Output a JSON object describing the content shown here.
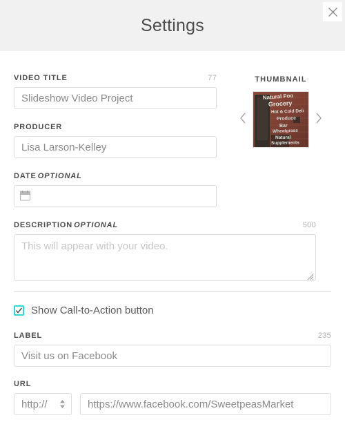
{
  "header": {
    "title": "Settings",
    "close_icon": "close-icon"
  },
  "form": {
    "video_title": {
      "label": "VIDEO TITLE",
      "counter": "77",
      "value": "Slideshow Video Project"
    },
    "producer": {
      "label": "PRODUCER",
      "value": "Lisa Larson-Kelley"
    },
    "date": {
      "label": "DATE",
      "optional": "OPTIONAL",
      "value": "",
      "placeholder": "",
      "icon": "calendar-icon"
    },
    "description": {
      "label": "DESCRIPTION",
      "optional": "OPTIONAL",
      "counter": "500",
      "value": "",
      "placeholder": "This will appear with your video."
    }
  },
  "thumbnail": {
    "label": "THUMBNAIL",
    "prev_icon": "chevron-left-icon",
    "next_icon": "chevron-right-icon",
    "image_alt": "storefront-brick-wall-painted-sign",
    "sign_lines": [
      "Natural Foods",
      "Grocery",
      "Hot & Cold Deli",
      "Produce",
      "Bar",
      "Wheatgrass",
      "Natural",
      "Supplements"
    ]
  },
  "cta": {
    "checkbox_label": "Show Call-to-Action button",
    "checkbox_checked": true,
    "checkbox_accent": "#2ed9de",
    "label_field": {
      "label": "LABEL",
      "counter": "235",
      "value": "Visit us on Facebook"
    },
    "url_field": {
      "label": "URL",
      "protocol": "http://",
      "value": "https://www.facebook.com/SweetpeasMarket"
    }
  }
}
